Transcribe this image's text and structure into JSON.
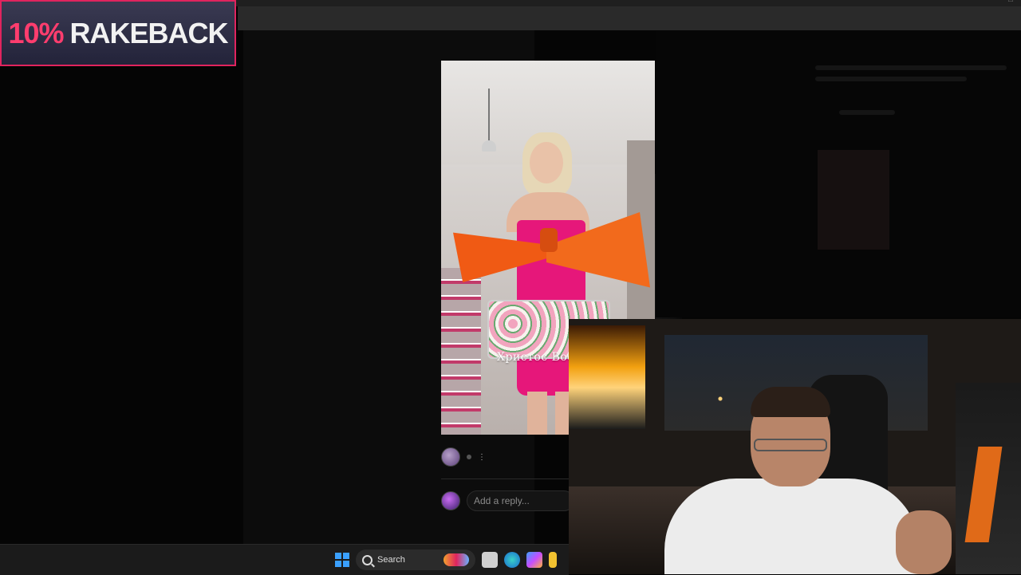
{
  "promo": {
    "percent": "10%",
    "word": "RAKEBACK",
    "accent": "#e0245e"
  },
  "story": {
    "caption": "Христос Вос",
    "reply_placeholder": "Add a reply...",
    "more_label": "⋮"
  },
  "taskbar": {
    "search_label": "Search",
    "apps": [
      "windows-start-icon",
      "search-icon",
      "file-explorer-icon",
      "edge-icon",
      "copilot-icon",
      "folder-icon"
    ]
  },
  "colors": {
    "page_bg": "#050505",
    "dress": "#e6177a",
    "bow": "#f26a1c",
    "taskbar_bg": "#1b1b1b"
  }
}
